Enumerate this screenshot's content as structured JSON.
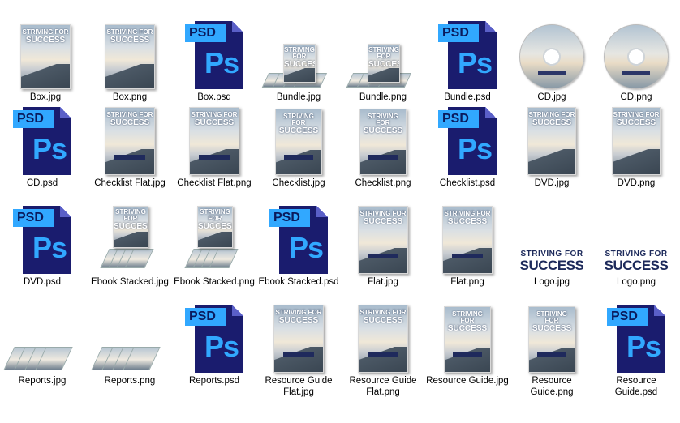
{
  "cover_title": {
    "line1": "STRIVING FOR",
    "line2": "SUCCESS"
  },
  "psd_icon": {
    "tag": "PSD",
    "glyph": "Ps"
  },
  "logo": {
    "line1": "STRIVING FOR",
    "line2": "SUCCESS"
  },
  "files": [
    {
      "label": "Box.jpg",
      "kind": "box"
    },
    {
      "label": "Box.png",
      "kind": "box"
    },
    {
      "label": "Box.psd",
      "kind": "psd"
    },
    {
      "label": "Bundle.jpg",
      "kind": "bundle"
    },
    {
      "label": "Bundle.png",
      "kind": "bundle"
    },
    {
      "label": "Bundle.psd",
      "kind": "psd"
    },
    {
      "label": "CD.jpg",
      "kind": "cd"
    },
    {
      "label": "CD.png",
      "kind": "cd"
    },
    {
      "label": "CD.psd",
      "kind": "psd"
    },
    {
      "label": "Checklist Flat.jpg",
      "kind": "flat"
    },
    {
      "label": "Checklist Flat.png",
      "kind": "flat"
    },
    {
      "label": "Checklist.jpg",
      "kind": "book"
    },
    {
      "label": "Checklist.png",
      "kind": "book"
    },
    {
      "label": "Checklist.psd",
      "kind": "psd"
    },
    {
      "label": "DVD.jpg",
      "kind": "dvd"
    },
    {
      "label": "DVD.png",
      "kind": "dvd"
    },
    {
      "label": "DVD.psd",
      "kind": "psd"
    },
    {
      "label": "Ebook Stacked.jpg",
      "kind": "stack"
    },
    {
      "label": "Ebook Stacked.png",
      "kind": "stack"
    },
    {
      "label": "Ebook Stacked.psd",
      "kind": "psd"
    },
    {
      "label": "Flat.jpg",
      "kind": "flat"
    },
    {
      "label": "Flat.png",
      "kind": "flat"
    },
    {
      "label": "Logo.jpg",
      "kind": "logo"
    },
    {
      "label": "Logo.png",
      "kind": "logo"
    },
    {
      "label": "Reports.jpg",
      "kind": "reports"
    },
    {
      "label": "Reports.png",
      "kind": "reports"
    },
    {
      "label": "Reports.psd",
      "kind": "psd"
    },
    {
      "label": "Resource Guide Flat.jpg",
      "kind": "flat"
    },
    {
      "label": "Resource Guide Flat.png",
      "kind": "flat"
    },
    {
      "label": "Resource Guide.jpg",
      "kind": "book"
    },
    {
      "label": "Resource Guide.png",
      "kind": "book"
    },
    {
      "label": "Resource Guide.psd",
      "kind": "psd"
    }
  ]
}
